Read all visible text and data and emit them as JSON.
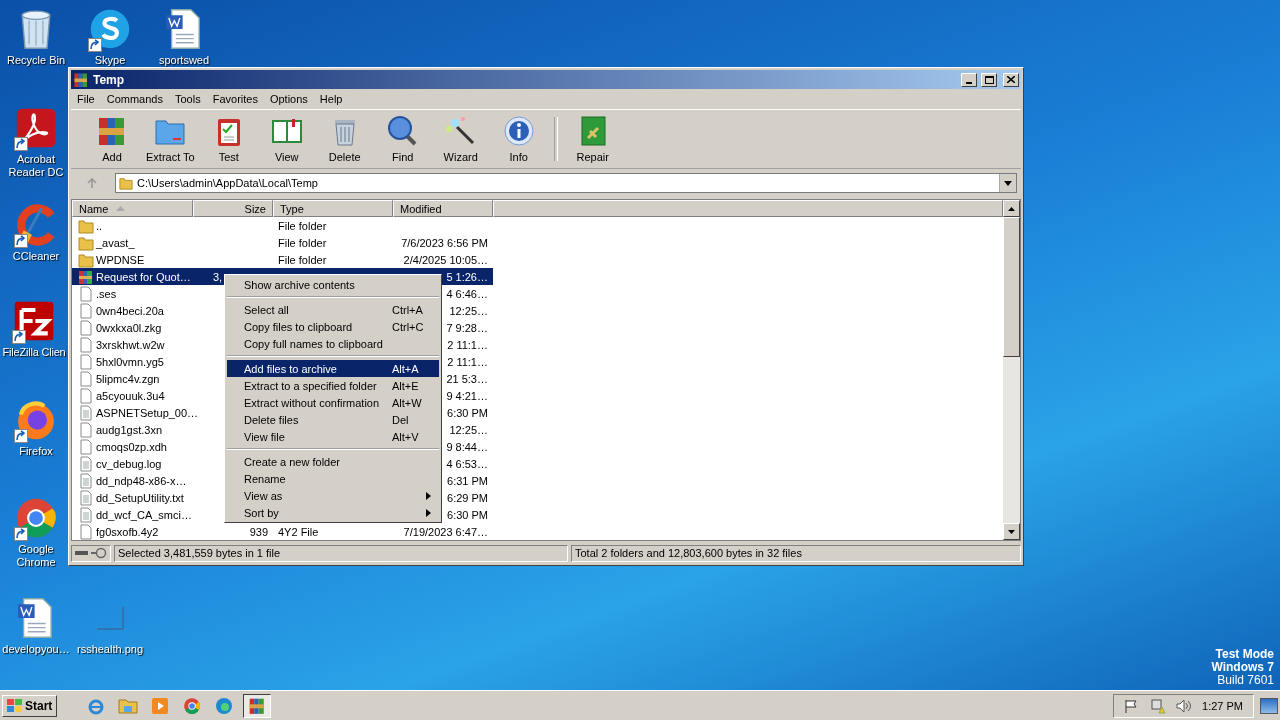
{
  "desktop_icons": [
    {
      "label": "Recycle Bin",
      "kind": "recycle",
      "shortcut": false
    },
    {
      "label": "Skype",
      "kind": "skype",
      "shortcut": true
    },
    {
      "label": "sportswed",
      "kind": "word",
      "shortcut": false
    },
    {
      "label": "Acrobat Reader DC",
      "kind": "acrobat",
      "shortcut": true
    },
    {
      "label": "CCleaner",
      "kind": "ccleaner",
      "shortcut": true
    },
    {
      "label": "FileZilla Clien",
      "kind": "filezilla",
      "shortcut": true
    },
    {
      "label": "Firefox",
      "kind": "firefox",
      "shortcut": true
    },
    {
      "label": "Google Chrome",
      "kind": "chrome",
      "shortcut": true
    },
    {
      "label": "developyou…",
      "kind": "word",
      "shortcut": false
    },
    {
      "label": "rsshealth.png",
      "kind": "blank",
      "shortcut": false
    }
  ],
  "window": {
    "title": "Temp",
    "menu": [
      "File",
      "Commands",
      "Tools",
      "Favorites",
      "Options",
      "Help"
    ],
    "toolbar": [
      {
        "label": "Add"
      },
      {
        "label": "Extract To"
      },
      {
        "label": "Test"
      },
      {
        "label": "View"
      },
      {
        "label": "Delete"
      },
      {
        "label": "Find"
      },
      {
        "label": "Wizard"
      },
      {
        "label": "Info"
      },
      {
        "label": "Repair"
      }
    ],
    "path": "C:\\Users\\admin\\AppData\\Local\\Temp",
    "columns": [
      "Name",
      "Size",
      "Type",
      "Modified"
    ],
    "rows": [
      {
        "kind": "folder",
        "name": "..",
        "type": "File folder",
        "selected": false
      },
      {
        "kind": "folder",
        "name": "_avast_",
        "type": "File folder",
        "modified": "7/6/2023 6:56 PM",
        "selected": false
      },
      {
        "kind": "folder",
        "name": "WPDNSE",
        "type": "File folder",
        "modified": "2/4/2025 10:05…",
        "selected": false
      },
      {
        "kind": "archive",
        "name": "Request for Quot…",
        "size": "3,",
        "modified": "5 1:26…",
        "selected": true
      },
      {
        "kind": "file",
        "name": ".ses",
        "modified": "4 6:46…",
        "selected": false
      },
      {
        "kind": "file",
        "name": "0wn4beci.20a",
        "modified": "12:25…",
        "selected": false
      },
      {
        "kind": "file",
        "name": "0wxkxa0l.zkg",
        "modified": "7 9:28…",
        "selected": false
      },
      {
        "kind": "file",
        "name": "3xrskhwt.w2w",
        "modified": "2 11:1…",
        "selected": false
      },
      {
        "kind": "file",
        "name": "5hxl0vmn.yg5",
        "modified": "2 11:1…",
        "selected": false
      },
      {
        "kind": "file",
        "name": "5lipmc4v.zgn",
        "modified": "21 5:3…",
        "selected": false
      },
      {
        "kind": "file",
        "name": "a5cyouuk.3u4",
        "modified": "9 4:21…",
        "selected": false
      },
      {
        "kind": "text",
        "name": "ASPNETSetup_00…",
        "modified": "6:30 PM",
        "selected": false
      },
      {
        "kind": "file",
        "name": "audg1gst.3xn",
        "modified": "12:25…",
        "selected": false
      },
      {
        "kind": "file",
        "name": "cmoqs0zp.xdh",
        "modified": "9 8:44…",
        "selected": false
      },
      {
        "kind": "text",
        "name": "cv_debug.log",
        "modified": "4 6:53…",
        "selected": false
      },
      {
        "kind": "text",
        "name": "dd_ndp48-x86-x…",
        "modified": "6:31 PM",
        "selected": false
      },
      {
        "kind": "text",
        "name": "dd_SetupUtility.txt",
        "modified": "6:29 PM",
        "selected": false
      },
      {
        "kind": "text",
        "name": "dd_wcf_CA_smci…",
        "modified": "6:30 PM",
        "selected": false
      },
      {
        "kind": "file",
        "name": "fg0sxofb.4y2",
        "size": "939",
        "type": "4Y2 File",
        "modified": "7/19/2023 6:47…",
        "selected": false
      }
    ],
    "status_left": "Selected 3,481,559 bytes in 1 file",
    "status_right": "Total 2 folders and 12,803,600 bytes in 32 files"
  },
  "context_menu": [
    {
      "kind": "item",
      "label": "Show archive contents",
      "submenu": false,
      "selected": false
    },
    {
      "kind": "separator"
    },
    {
      "kind": "item",
      "label": "Select all",
      "shortcut": "Ctrl+A",
      "submenu": false,
      "selected": false
    },
    {
      "kind": "item",
      "label": "Copy files to clipboard",
      "shortcut": "Ctrl+C",
      "submenu": false,
      "selected": false
    },
    {
      "kind": "item",
      "label": "Copy full names to clipboard",
      "submenu": false,
      "selected": false
    },
    {
      "kind": "separator"
    },
    {
      "kind": "item",
      "label": "Add files to archive",
      "shortcut": "Alt+A",
      "submenu": false,
      "selected": true
    },
    {
      "kind": "item",
      "label": "Extract to a specified folder",
      "shortcut": "Alt+E",
      "submenu": false,
      "selected": false
    },
    {
      "kind": "item",
      "label": "Extract without confirmation",
      "shortcut": "Alt+W",
      "submenu": false,
      "selected": false
    },
    {
      "kind": "item",
      "label": "Delete files",
      "shortcut": "Del",
      "submenu": false,
      "selected": false
    },
    {
      "kind": "item",
      "label": "View file",
      "shortcut": "Alt+V",
      "submenu": false,
      "selected": false
    },
    {
      "kind": "separator"
    },
    {
      "kind": "item",
      "label": "Create a new folder",
      "submenu": false,
      "selected": false
    },
    {
      "kind": "item",
      "label": "Rename",
      "submenu": false,
      "selected": false
    },
    {
      "kind": "item",
      "label": "View as",
      "submenu": true,
      "selected": false
    },
    {
      "kind": "item",
      "label": "Sort by",
      "submenu": true,
      "selected": false
    }
  ],
  "system_notice": [
    "Test Mode",
    "Windows 7",
    "Build 7601"
  ],
  "taskbar": {
    "start": "Start",
    "clock": "1:27 PM"
  }
}
